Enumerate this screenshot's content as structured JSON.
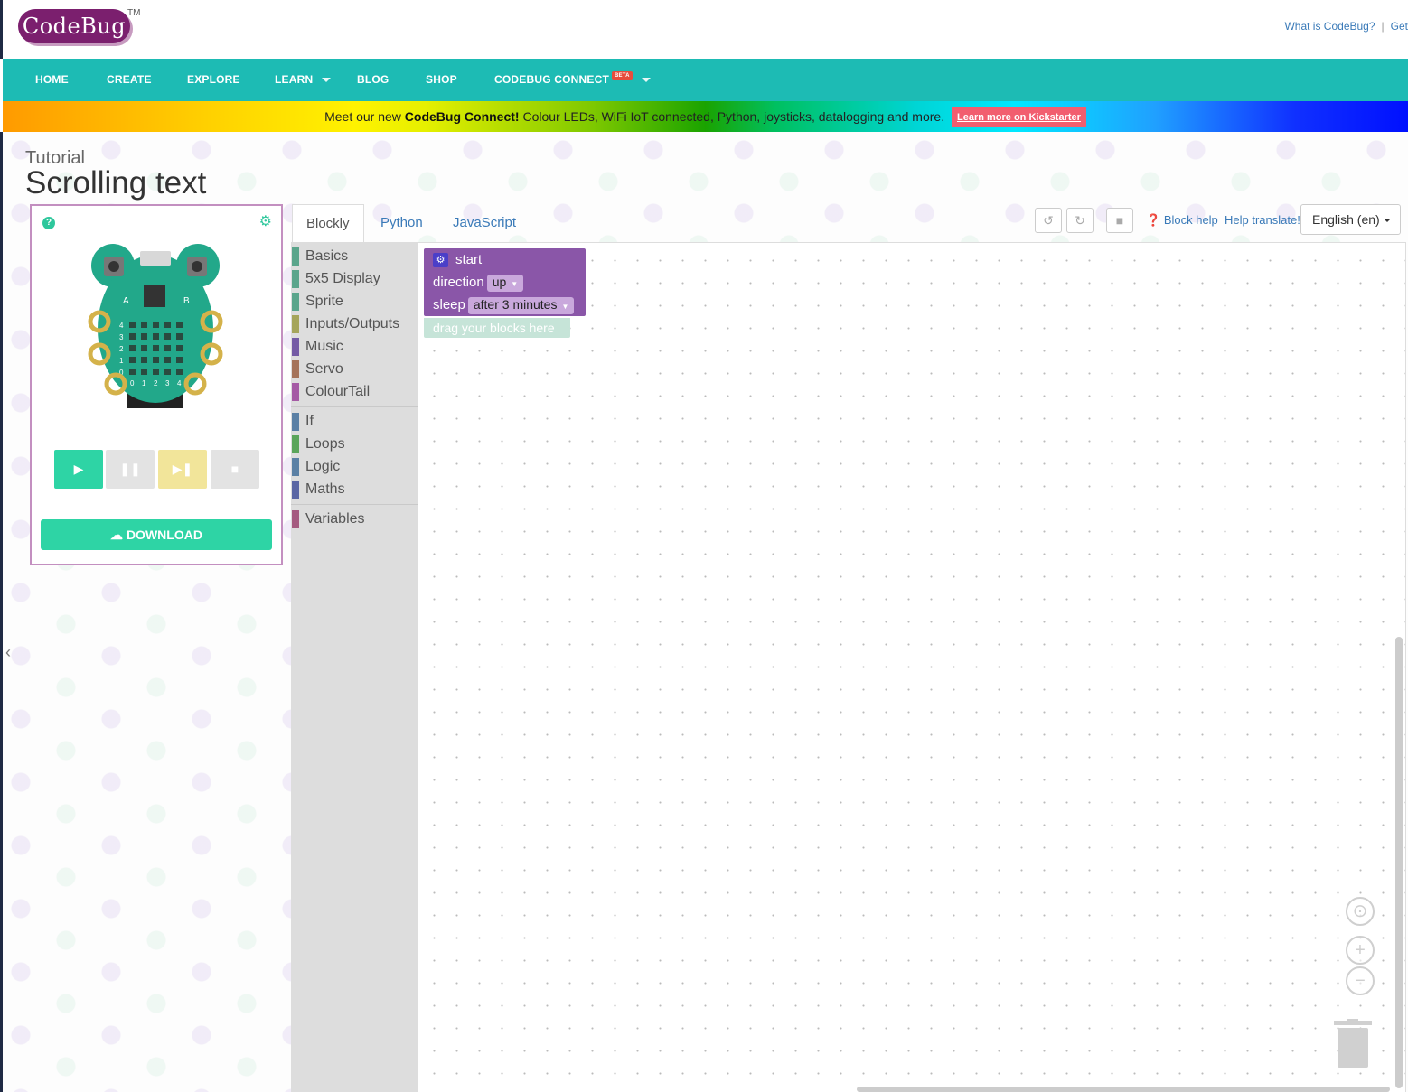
{
  "brand": {
    "logo_text": "CodeBug",
    "tm": "TM"
  },
  "top_links": [
    "What is CodeBug?",
    "Get"
  ],
  "nav": {
    "items": [
      "HOME",
      "CREATE",
      "EXPLORE",
      "LEARN",
      "BLOG",
      "SHOP",
      "CODEBUG CONNECT"
    ],
    "beta_badge": "BETA"
  },
  "banner": {
    "text_before": "Meet our new ",
    "highlight": "CodeBug Connect!",
    "text_after": " Colour LEDs, WiFi IoT connected, Python, joysticks, datalogging and more.",
    "button": "Learn more on Kickstarter"
  },
  "tutorial": {
    "label": "Tutorial",
    "title": "Scrolling text"
  },
  "simulator": {
    "help_icon": "?",
    "download_label": "DOWNLOAD",
    "button_a": "A",
    "button_b": "B",
    "row_labels": [
      "4",
      "3",
      "2",
      "1",
      "0"
    ],
    "col_labels": [
      "0",
      "1",
      "2",
      "3",
      "4"
    ]
  },
  "editor": {
    "tabs": [
      "Blockly",
      "Python",
      "JavaScript"
    ],
    "block_help": "Block help",
    "help_translate": "Help translate!",
    "language": "English (en)"
  },
  "toolbox": {
    "group1": [
      {
        "label": "Basics",
        "color": "#5ba58c"
      },
      {
        "label": "5x5 Display",
        "color": "#5ba58c"
      },
      {
        "label": "Sprite",
        "color": "#5ba58c"
      },
      {
        "label": "Inputs/Outputs",
        "color": "#a5a55b"
      },
      {
        "label": "Music",
        "color": "#745ba5"
      },
      {
        "label": "Servo",
        "color": "#a5745b"
      },
      {
        "label": "ColourTail",
        "color": "#a55ba5"
      }
    ],
    "group2": [
      {
        "label": "If",
        "color": "#5b80a5"
      },
      {
        "label": "Loops",
        "color": "#5ba55b"
      },
      {
        "label": "Logic",
        "color": "#5b80a5"
      },
      {
        "label": "Maths",
        "color": "#5b67a5"
      }
    ],
    "group3": [
      {
        "label": "Variables",
        "color": "#a55b80"
      }
    ]
  },
  "start_block": {
    "title": "start",
    "direction_label": "direction",
    "direction_value": "up",
    "sleep_label": "sleep",
    "sleep_value": "after 3 minutes",
    "drag_hint": "drag your blocks here"
  },
  "colors": {
    "nav": "#1dbbb4",
    "block": "#8a56a8",
    "accent_green": "#2ed4a5",
    "link": "#3a7ab8"
  }
}
